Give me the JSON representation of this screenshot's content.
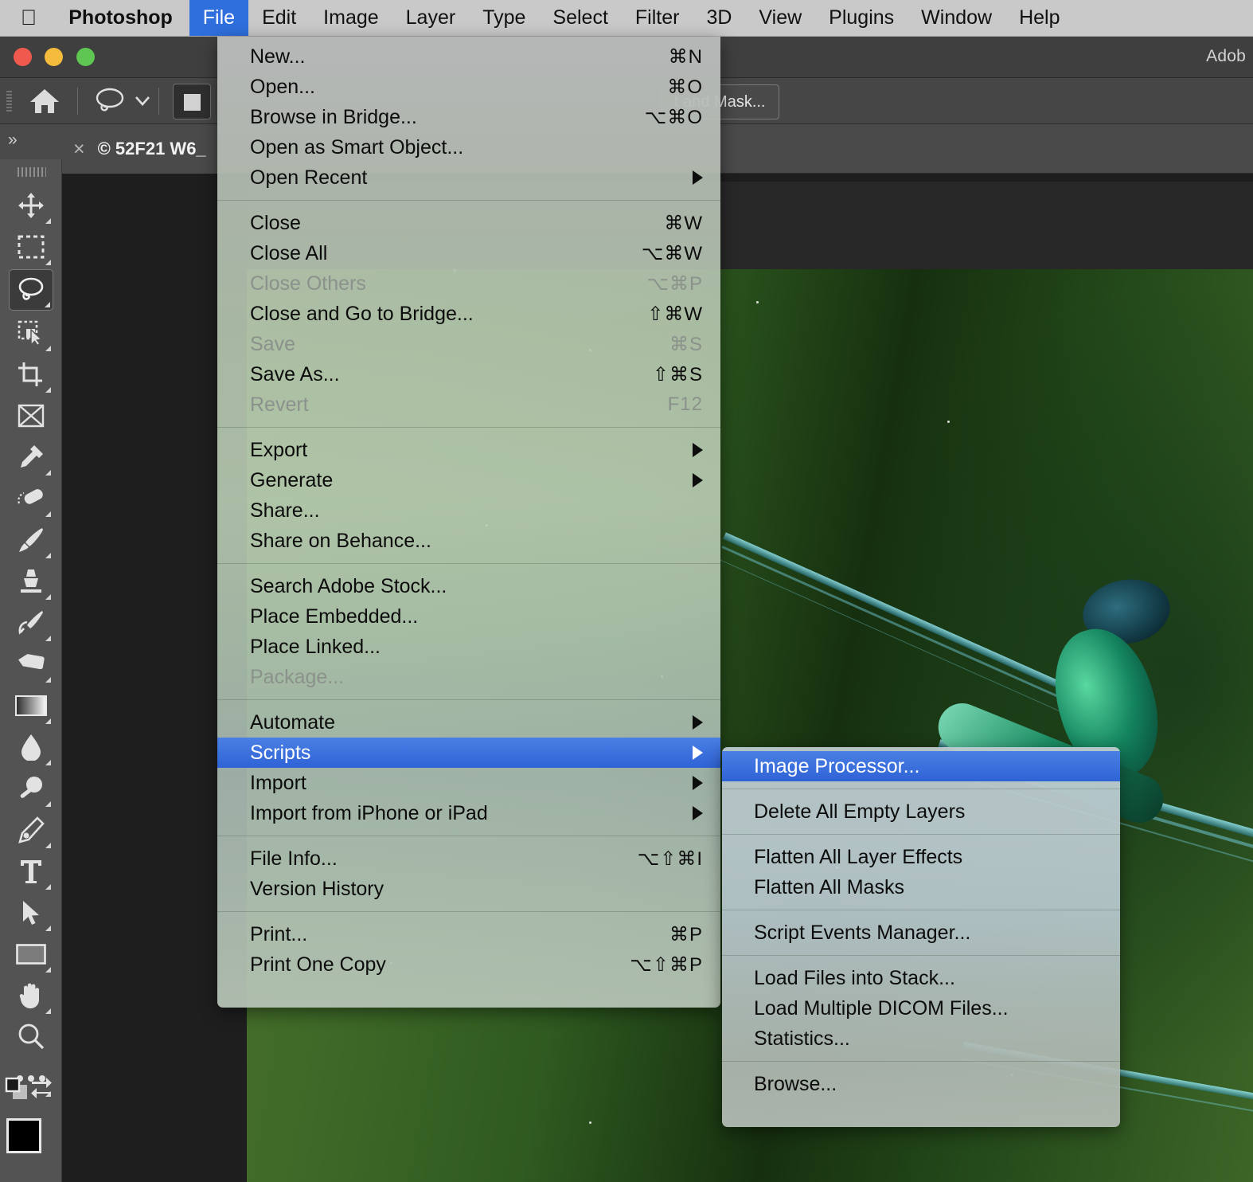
{
  "menubar": {
    "apple_icon": "apple-logo",
    "items": [
      {
        "label": "Photoshop",
        "bold": true,
        "open": false
      },
      {
        "label": "File",
        "bold": false,
        "open": true
      },
      {
        "label": "Edit",
        "bold": false,
        "open": false
      },
      {
        "label": "Image",
        "bold": false,
        "open": false
      },
      {
        "label": "Layer",
        "bold": false,
        "open": false
      },
      {
        "label": "Type",
        "bold": false,
        "open": false
      },
      {
        "label": "Select",
        "bold": false,
        "open": false
      },
      {
        "label": "Filter",
        "bold": false,
        "open": false
      },
      {
        "label": "3D",
        "bold": false,
        "open": false
      },
      {
        "label": "View",
        "bold": false,
        "open": false
      },
      {
        "label": "Plugins",
        "bold": false,
        "open": false
      },
      {
        "label": "Window",
        "bold": false,
        "open": false
      },
      {
        "label": "Help",
        "bold": false,
        "open": false
      }
    ]
  },
  "titlebar": {
    "app_name": "Adob",
    "traffic_lights": [
      "close-red",
      "minimize-yellow",
      "zoom-green"
    ]
  },
  "options_bar": {
    "home_icon": "home-icon",
    "lasso_tool_icon": "lasso-icon",
    "lasso_caret_icon": "chevron-down-icon",
    "mode_square_icon": "square-icon",
    "select_and_mask_label": "t and Mask..."
  },
  "tab_bar": {
    "collapse_icon": "»",
    "close_icon": "×",
    "document_title": "© 52F21 W6_"
  },
  "toolbar": {
    "tools": [
      {
        "name": "move-tool",
        "icon": "move-icon",
        "has_flyout": true,
        "active": false
      },
      {
        "name": "rectangular-marquee-tool",
        "icon": "marquee-icon",
        "has_flyout": true,
        "active": false
      },
      {
        "name": "lasso-tool",
        "icon": "lasso-icon",
        "has_flyout": true,
        "active": true
      },
      {
        "name": "object-selection-tool",
        "icon": "object-select-icon",
        "has_flyout": true,
        "active": false
      },
      {
        "name": "crop-tool",
        "icon": "crop-icon",
        "has_flyout": true,
        "active": false
      },
      {
        "name": "frame-tool",
        "icon": "frame-icon",
        "has_flyout": false,
        "active": false
      },
      {
        "name": "eyedropper-tool",
        "icon": "eyedropper-icon",
        "has_flyout": true,
        "active": false
      },
      {
        "name": "healing-brush-tool",
        "icon": "healing-brush-icon",
        "has_flyout": true,
        "active": false
      },
      {
        "name": "brush-tool",
        "icon": "brush-icon",
        "has_flyout": true,
        "active": false
      },
      {
        "name": "clone-stamp-tool",
        "icon": "clone-stamp-icon",
        "has_flyout": true,
        "active": false
      },
      {
        "name": "history-brush-tool",
        "icon": "history-brush-icon",
        "has_flyout": true,
        "active": false
      },
      {
        "name": "eraser-tool",
        "icon": "eraser-icon",
        "has_flyout": true,
        "active": false
      },
      {
        "name": "gradient-tool",
        "icon": "gradient-icon",
        "has_flyout": true,
        "active": false
      },
      {
        "name": "blur-tool",
        "icon": "blur-drop-icon",
        "has_flyout": true,
        "active": false
      },
      {
        "name": "dodge-tool",
        "icon": "dodge-icon",
        "has_flyout": true,
        "active": false
      },
      {
        "name": "pen-tool",
        "icon": "pen-icon",
        "has_flyout": true,
        "active": false
      },
      {
        "name": "type-tool",
        "icon": "type-t-icon",
        "has_flyout": true,
        "active": false
      },
      {
        "name": "path-selection-tool",
        "icon": "path-arrow-icon",
        "has_flyout": true,
        "active": false
      },
      {
        "name": "rectangle-tool",
        "icon": "rectangle-icon",
        "has_flyout": true,
        "active": false
      },
      {
        "name": "hand-tool",
        "icon": "hand-icon",
        "has_flyout": true,
        "active": false
      },
      {
        "name": "zoom-tool",
        "icon": "magnifier-icon",
        "has_flyout": false,
        "active": false
      },
      {
        "name": "edit-toolbar",
        "icon": "ellipsis-icon",
        "has_flyout": true,
        "active": false
      }
    ],
    "default_colors_icon": "default-colors-icon",
    "swap-colors_icon": "swap-arrows-icon",
    "foreground_color": "#000000",
    "background_color": "#ffffff"
  },
  "file_menu": {
    "highlight_color": "#2f63d6",
    "groups": [
      [
        {
          "label": "New...",
          "shortcut": "⌘N",
          "disabled": false,
          "submenu": false
        },
        {
          "label": "Open...",
          "shortcut": "⌘O",
          "disabled": false,
          "submenu": false
        },
        {
          "label": "Browse in Bridge...",
          "shortcut": "⌥⌘O",
          "disabled": false,
          "submenu": false
        },
        {
          "label": "Open as Smart Object...",
          "shortcut": "",
          "disabled": false,
          "submenu": false
        },
        {
          "label": "Open Recent",
          "shortcut": "",
          "disabled": false,
          "submenu": true
        }
      ],
      [
        {
          "label": "Close",
          "shortcut": "⌘W",
          "disabled": false,
          "submenu": false
        },
        {
          "label": "Close All",
          "shortcut": "⌥⌘W",
          "disabled": false,
          "submenu": false
        },
        {
          "label": "Close Others",
          "shortcut": "⌥⌘P",
          "disabled": true,
          "submenu": false
        },
        {
          "label": "Close and Go to Bridge...",
          "shortcut": "⇧⌘W",
          "disabled": false,
          "submenu": false
        },
        {
          "label": "Save",
          "shortcut": "⌘S",
          "disabled": true,
          "submenu": false
        },
        {
          "label": "Save As...",
          "shortcut": "⇧⌘S",
          "disabled": false,
          "submenu": false
        },
        {
          "label": "Revert",
          "shortcut": "F12",
          "disabled": true,
          "submenu": false
        }
      ],
      [
        {
          "label": "Export",
          "shortcut": "",
          "disabled": false,
          "submenu": true
        },
        {
          "label": "Generate",
          "shortcut": "",
          "disabled": false,
          "submenu": true
        },
        {
          "label": "Share...",
          "shortcut": "",
          "disabled": false,
          "submenu": false
        },
        {
          "label": "Share on Behance...",
          "shortcut": "",
          "disabled": false,
          "submenu": false
        }
      ],
      [
        {
          "label": "Search Adobe Stock...",
          "shortcut": "",
          "disabled": false,
          "submenu": false
        },
        {
          "label": "Place Embedded...",
          "shortcut": "",
          "disabled": false,
          "submenu": false
        },
        {
          "label": "Place Linked...",
          "shortcut": "",
          "disabled": false,
          "submenu": false
        },
        {
          "label": "Package...",
          "shortcut": "",
          "disabled": true,
          "submenu": false
        }
      ],
      [
        {
          "label": "Automate",
          "shortcut": "",
          "disabled": false,
          "submenu": true
        },
        {
          "label": "Scripts",
          "shortcut": "",
          "disabled": false,
          "submenu": true,
          "selected": true
        },
        {
          "label": "Import",
          "shortcut": "",
          "disabled": false,
          "submenu": true
        },
        {
          "label": "Import from iPhone or iPad",
          "shortcut": "",
          "disabled": false,
          "submenu": true
        }
      ],
      [
        {
          "label": "File Info...",
          "shortcut": "⌥⇧⌘I",
          "disabled": false,
          "submenu": false
        },
        {
          "label": "Version History",
          "shortcut": "",
          "disabled": false,
          "submenu": false
        }
      ],
      [
        {
          "label": "Print...",
          "shortcut": "⌘P",
          "disabled": false,
          "submenu": false
        },
        {
          "label": "Print One Copy",
          "shortcut": "⌥⇧⌘P",
          "disabled": false,
          "submenu": false
        }
      ]
    ]
  },
  "scripts_submenu": {
    "groups": [
      [
        {
          "label": "Image Processor...",
          "selected": true
        }
      ],
      [
        {
          "label": "Delete All Empty Layers",
          "selected": false
        }
      ],
      [
        {
          "label": "Flatten All Layer Effects",
          "selected": false
        },
        {
          "label": "Flatten All Masks",
          "selected": false
        }
      ],
      [
        {
          "label": "Script Events Manager...",
          "selected": false
        }
      ],
      [
        {
          "label": "Load Files into Stack...",
          "selected": false
        },
        {
          "label": "Load Multiple DICOM Files...",
          "selected": false
        },
        {
          "label": "Statistics...",
          "selected": false
        }
      ],
      [
        {
          "label": "Browse...",
          "selected": false
        }
      ]
    ]
  }
}
